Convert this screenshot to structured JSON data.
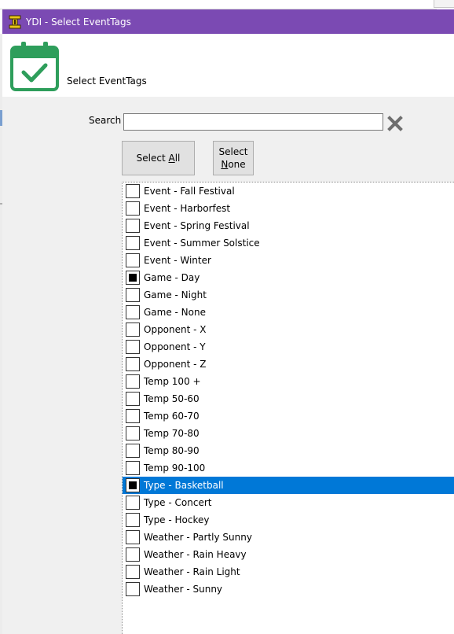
{
  "window": {
    "title": "YDI - Select EventTags"
  },
  "header": {
    "label": "Select EventTags",
    "icon": "calendar-check-icon"
  },
  "search": {
    "label": "Search",
    "value": "",
    "placeholder": "",
    "clear_icon": "close-x-icon"
  },
  "buttons": {
    "select_all_prefix": "Select ",
    "select_all_accel": "A",
    "select_all_suffix": "ll",
    "select_none_line1": "Select",
    "select_none_accel": "N",
    "select_none_suffix": "one"
  },
  "colors": {
    "titlebar": "#7b4ab3",
    "calendar": "#2e9e5b",
    "selection": "#0078d7"
  },
  "tags": [
    {
      "label": "Event - Fall Festival",
      "checked": false,
      "selected": false
    },
    {
      "label": "Event - Harborfest",
      "checked": false,
      "selected": false
    },
    {
      "label": "Event - Spring Festival",
      "checked": false,
      "selected": false
    },
    {
      "label": "Event - Summer Solstice",
      "checked": false,
      "selected": false
    },
    {
      "label": "Event - Winter",
      "checked": false,
      "selected": false
    },
    {
      "label": "Game - Day",
      "checked": true,
      "selected": false
    },
    {
      "label": "Game - Night",
      "checked": false,
      "selected": false
    },
    {
      "label": "Game - None",
      "checked": false,
      "selected": false
    },
    {
      "label": "Opponent - X",
      "checked": false,
      "selected": false
    },
    {
      "label": "Opponent - Y",
      "checked": false,
      "selected": false
    },
    {
      "label": "Opponent - Z",
      "checked": false,
      "selected": false
    },
    {
      "label": "Temp 100 +",
      "checked": false,
      "selected": false
    },
    {
      "label": "Temp 50-60",
      "checked": false,
      "selected": false
    },
    {
      "label": "Temp 60-70",
      "checked": false,
      "selected": false
    },
    {
      "label": "Temp 70-80",
      "checked": false,
      "selected": false
    },
    {
      "label": "Temp 80-90",
      "checked": false,
      "selected": false
    },
    {
      "label": "Temp 90-100",
      "checked": false,
      "selected": false
    },
    {
      "label": "Type - Basketball",
      "checked": true,
      "selected": true
    },
    {
      "label": "Type - Concert",
      "checked": false,
      "selected": false
    },
    {
      "label": "Type - Hockey",
      "checked": false,
      "selected": false
    },
    {
      "label": "Weather - Partly Sunny",
      "checked": false,
      "selected": false
    },
    {
      "label": "Weather - Rain Heavy",
      "checked": false,
      "selected": false
    },
    {
      "label": "Weather - Rain Light",
      "checked": false,
      "selected": false
    },
    {
      "label": "Weather - Sunny",
      "checked": false,
      "selected": false
    }
  ]
}
